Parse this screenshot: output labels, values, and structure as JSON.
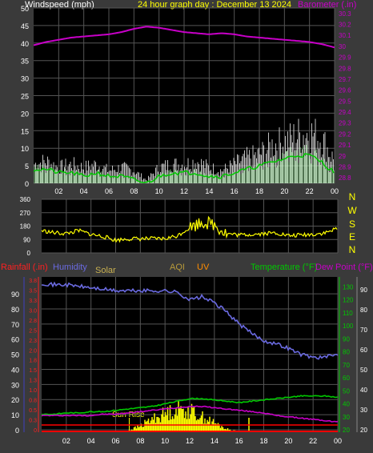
{
  "colors": {
    "background": "#3a3a3a",
    "plot_bg": "#000000",
    "grid": "#555555",
    "axis_text": "#ffffff",
    "gust": "#ffffff",
    "avg_wind": "#00c800",
    "light_wind": "#9cf09c",
    "barometer": "#c800c8",
    "direction": "#ffff00",
    "rainfall": "#ff0000",
    "humidity": "#6a6ae0",
    "solar": "#ffff00",
    "temperature": "#00c800",
    "dewpoint": "#c800c8",
    "aqi": "#b89a3a",
    "uv": "#ff8c00",
    "solar_label": "#c8b050",
    "rain_red_axis": "#ff2020",
    "green_axis": "#00c800"
  },
  "header": {
    "windspeed": "Windspeed (mph)",
    "graph_day": "24 hour graph day : December 13 2024",
    "barometer": "Barometer (.in)"
  },
  "bottom_header": {
    "rainfall": "Rainfall (.in)",
    "humidity": "Humidity",
    "solar": "Solar",
    "aqi": "AQI",
    "uv": "UV",
    "temperature": "Temperature (°F)",
    "dewpoint": "Dew Point (°F)"
  },
  "annotations": {
    "sun_rise": "Sun Rise"
  },
  "compass": [
    "N",
    "W",
    "S",
    "E",
    "N"
  ],
  "chart_data": [
    {
      "type": "line",
      "title": "24 hour graph day : December 13 2024",
      "x_ticks": [
        "02",
        "04",
        "06",
        "08",
        "10",
        "12",
        "14",
        "16",
        "18",
        "20",
        "22",
        "00"
      ],
      "ylabel": "Windspeed (mph)",
      "y_ticks": [
        "0",
        "5",
        "10",
        "15",
        "20",
        "25",
        "30",
        "35",
        "40",
        "45",
        "50"
      ],
      "ylim": [
        0,
        50
      ],
      "y2label": "Barometer (.in)",
      "y2_ticks": [
        "28.8",
        "28.9",
        "29",
        "29.1",
        "29.2",
        "29.3",
        "29.4",
        "29.5",
        "29.6",
        "29.7",
        "29.8",
        "29.9",
        "30",
        "30.1",
        "30.2",
        "30.3"
      ],
      "y2lim": [
        28.75,
        30.35
      ],
      "x": [
        0,
        1,
        2,
        3,
        4,
        5,
        6,
        7,
        8,
        9,
        10,
        11,
        12,
        13,
        14,
        15,
        16,
        17,
        18,
        19,
        20,
        21,
        22,
        23,
        24
      ],
      "series": [
        {
          "name": "gust",
          "values": [
            6,
            7,
            5,
            6,
            5,
            6,
            4,
            5,
            4,
            1,
            5,
            6,
            6,
            7,
            5,
            4,
            6,
            8,
            9,
            12,
            13,
            15,
            16,
            14,
            7
          ]
        },
        {
          "name": "average",
          "values": [
            4,
            4,
            3,
            3,
            2,
            3,
            2,
            2,
            1,
            0,
            2,
            3,
            3,
            3,
            2,
            2,
            3,
            4,
            5,
            6,
            7,
            8,
            8,
            6,
            3
          ]
        },
        {
          "name": "barometer",
          "values": [
            30.01,
            30.04,
            30.06,
            30.08,
            30.09,
            30.1,
            30.11,
            30.13,
            30.16,
            30.18,
            30.17,
            30.15,
            30.13,
            30.12,
            30.11,
            30.12,
            30.11,
            30.09,
            30.08,
            30.07,
            30.06,
            30.05,
            30.04,
            30.02,
            29.99
          ]
        }
      ]
    },
    {
      "type": "line",
      "ylabel": "Wind direction",
      "y_ticks": [
        "0",
        "90",
        "180",
        "270",
        "360"
      ],
      "ylim": [
        0,
        360
      ],
      "x": [
        0,
        1,
        2,
        3,
        4,
        5,
        6,
        7,
        8,
        9,
        10,
        11,
        12,
        13,
        14,
        15,
        16,
        17,
        18,
        19,
        20,
        21,
        22,
        23,
        24
      ],
      "series": [
        {
          "name": "direction",
          "values": [
            150,
            135,
            130,
            150,
            125,
            110,
            85,
            95,
            95,
            95,
            95,
            115,
            170,
            210,
            190,
            130,
            120,
            125,
            130,
            135,
            115,
            120,
            125,
            135,
            165
          ]
        }
      ]
    },
    {
      "type": "line",
      "y_left_ticks": [
        "0",
        "10",
        "20",
        "30",
        "40",
        "50",
        "60",
        "70",
        "80",
        "90"
      ],
      "y_rain_ticks": [
        "0",
        "0.3",
        "0.5",
        "0.8",
        "1.0",
        "1.3",
        "1.5",
        "1.8",
        "2.0",
        "2.3",
        "2.5",
        "2.8",
        "3.0",
        "3.3",
        "3.5",
        "3.8"
      ],
      "y_right_ticks": [
        "20",
        "30",
        "40",
        "50",
        "60",
        "70",
        "80",
        "90",
        "100",
        "110",
        "120",
        "130"
      ],
      "y_far_right_ticks": [
        "20",
        "30",
        "40",
        "50",
        "60",
        "70",
        "80",
        "90"
      ],
      "x": [
        0,
        1,
        2,
        3,
        4,
        5,
        6,
        7,
        8,
        9,
        10,
        11,
        12,
        13,
        14,
        15,
        16,
        17,
        18,
        19,
        20,
        21,
        22,
        23,
        24
      ],
      "series": [
        {
          "name": "Humidity",
          "values": [
            97,
            96,
            96,
            95,
            94,
            93,
            92,
            92,
            92,
            92,
            92,
            91,
            86,
            88,
            84,
            78,
            70,
            64,
            59,
            57,
            54,
            50,
            48,
            48,
            50
          ]
        },
        {
          "name": "Temperature",
          "values": [
            32,
            32,
            33,
            33,
            34,
            34,
            35,
            36,
            37,
            38,
            40,
            42,
            44,
            44,
            43,
            42,
            41,
            42,
            43,
            44,
            45,
            46,
            46,
            46,
            45
          ]
        },
        {
          "name": "Dew Point",
          "values": [
            31,
            31,
            31,
            31,
            31,
            32,
            32,
            33,
            34,
            35,
            36,
            37,
            38,
            38,
            37,
            36,
            35,
            34,
            33,
            31,
            30,
            29,
            28,
            27,
            26
          ]
        },
        {
          "name": "Solar",
          "values": [
            0,
            0,
            0,
            0,
            0,
            0,
            0,
            0.05,
            0.2,
            0.45,
            0.6,
            0.75,
            0.7,
            0.5,
            0.3,
            0.1,
            0.02,
            0,
            0,
            0,
            0,
            0,
            0,
            0,
            0
          ]
        },
        {
          "name": "Rainfall",
          "values": [
            0,
            0,
            0,
            0,
            0,
            0,
            0,
            0,
            0,
            0,
            0,
            0,
            0,
            0,
            0,
            0,
            0,
            0,
            0,
            0,
            0,
            0,
            0,
            0,
            0
          ]
        }
      ]
    }
  ]
}
